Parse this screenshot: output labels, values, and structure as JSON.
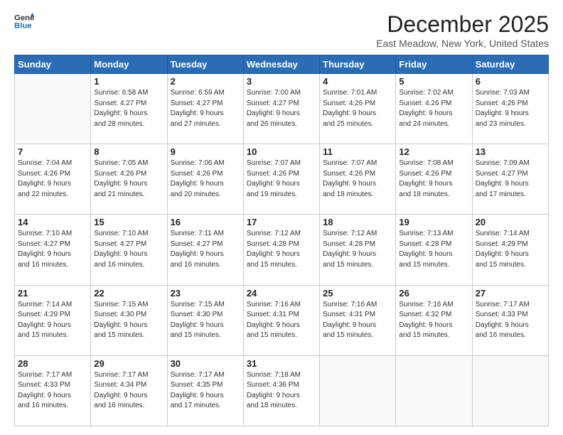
{
  "logo": {
    "general": "General",
    "blue": "Blue"
  },
  "header": {
    "month": "December 2025",
    "location": "East Meadow, New York, United States"
  },
  "weekdays": [
    "Sunday",
    "Monday",
    "Tuesday",
    "Wednesday",
    "Thursday",
    "Friday",
    "Saturday"
  ],
  "weeks": [
    [
      {
        "day": "",
        "info": ""
      },
      {
        "day": "1",
        "info": "Sunrise: 6:58 AM\nSunset: 4:27 PM\nDaylight: 9 hours\nand 28 minutes."
      },
      {
        "day": "2",
        "info": "Sunrise: 6:59 AM\nSunset: 4:27 PM\nDaylight: 9 hours\nand 27 minutes."
      },
      {
        "day": "3",
        "info": "Sunrise: 7:00 AM\nSunset: 4:27 PM\nDaylight: 9 hours\nand 26 minutes."
      },
      {
        "day": "4",
        "info": "Sunrise: 7:01 AM\nSunset: 4:26 PM\nDaylight: 9 hours\nand 25 minutes."
      },
      {
        "day": "5",
        "info": "Sunrise: 7:02 AM\nSunset: 4:26 PM\nDaylight: 9 hours\nand 24 minutes."
      },
      {
        "day": "6",
        "info": "Sunrise: 7:03 AM\nSunset: 4:26 PM\nDaylight: 9 hours\nand 23 minutes."
      }
    ],
    [
      {
        "day": "7",
        "info": "Sunrise: 7:04 AM\nSunset: 4:26 PM\nDaylight: 9 hours\nand 22 minutes."
      },
      {
        "day": "8",
        "info": "Sunrise: 7:05 AM\nSunset: 4:26 PM\nDaylight: 9 hours\nand 21 minutes."
      },
      {
        "day": "9",
        "info": "Sunrise: 7:06 AM\nSunset: 4:26 PM\nDaylight: 9 hours\nand 20 minutes."
      },
      {
        "day": "10",
        "info": "Sunrise: 7:07 AM\nSunset: 4:26 PM\nDaylight: 9 hours\nand 19 minutes."
      },
      {
        "day": "11",
        "info": "Sunrise: 7:07 AM\nSunset: 4:26 PM\nDaylight: 9 hours\nand 18 minutes."
      },
      {
        "day": "12",
        "info": "Sunrise: 7:08 AM\nSunset: 4:26 PM\nDaylight: 9 hours\nand 18 minutes."
      },
      {
        "day": "13",
        "info": "Sunrise: 7:09 AM\nSunset: 4:27 PM\nDaylight: 9 hours\nand 17 minutes."
      }
    ],
    [
      {
        "day": "14",
        "info": "Sunrise: 7:10 AM\nSunset: 4:27 PM\nDaylight: 9 hours\nand 16 minutes."
      },
      {
        "day": "15",
        "info": "Sunrise: 7:10 AM\nSunset: 4:27 PM\nDaylight: 9 hours\nand 16 minutes."
      },
      {
        "day": "16",
        "info": "Sunrise: 7:11 AM\nSunset: 4:27 PM\nDaylight: 9 hours\nand 16 minutes."
      },
      {
        "day": "17",
        "info": "Sunrise: 7:12 AM\nSunset: 4:28 PM\nDaylight: 9 hours\nand 15 minutes."
      },
      {
        "day": "18",
        "info": "Sunrise: 7:12 AM\nSunset: 4:28 PM\nDaylight: 9 hours\nand 15 minutes."
      },
      {
        "day": "19",
        "info": "Sunrise: 7:13 AM\nSunset: 4:28 PM\nDaylight: 9 hours\nand 15 minutes."
      },
      {
        "day": "20",
        "info": "Sunrise: 7:14 AM\nSunset: 4:29 PM\nDaylight: 9 hours\nand 15 minutes."
      }
    ],
    [
      {
        "day": "21",
        "info": "Sunrise: 7:14 AM\nSunset: 4:29 PM\nDaylight: 9 hours\nand 15 minutes."
      },
      {
        "day": "22",
        "info": "Sunrise: 7:15 AM\nSunset: 4:30 PM\nDaylight: 9 hours\nand 15 minutes."
      },
      {
        "day": "23",
        "info": "Sunrise: 7:15 AM\nSunset: 4:30 PM\nDaylight: 9 hours\nand 15 minutes."
      },
      {
        "day": "24",
        "info": "Sunrise: 7:16 AM\nSunset: 4:31 PM\nDaylight: 9 hours\nand 15 minutes."
      },
      {
        "day": "25",
        "info": "Sunrise: 7:16 AM\nSunset: 4:31 PM\nDaylight: 9 hours\nand 15 minutes."
      },
      {
        "day": "26",
        "info": "Sunrise: 7:16 AM\nSunset: 4:32 PM\nDaylight: 9 hours\nand 15 minutes."
      },
      {
        "day": "27",
        "info": "Sunrise: 7:17 AM\nSunset: 4:33 PM\nDaylight: 9 hours\nand 16 minutes."
      }
    ],
    [
      {
        "day": "28",
        "info": "Sunrise: 7:17 AM\nSunset: 4:33 PM\nDaylight: 9 hours\nand 16 minutes."
      },
      {
        "day": "29",
        "info": "Sunrise: 7:17 AM\nSunset: 4:34 PM\nDaylight: 9 hours\nand 16 minutes."
      },
      {
        "day": "30",
        "info": "Sunrise: 7:17 AM\nSunset: 4:35 PM\nDaylight: 9 hours\nand 17 minutes."
      },
      {
        "day": "31",
        "info": "Sunrise: 7:18 AM\nSunset: 4:36 PM\nDaylight: 9 hours\nand 18 minutes."
      },
      {
        "day": "",
        "info": ""
      },
      {
        "day": "",
        "info": ""
      },
      {
        "day": "",
        "info": ""
      }
    ]
  ]
}
